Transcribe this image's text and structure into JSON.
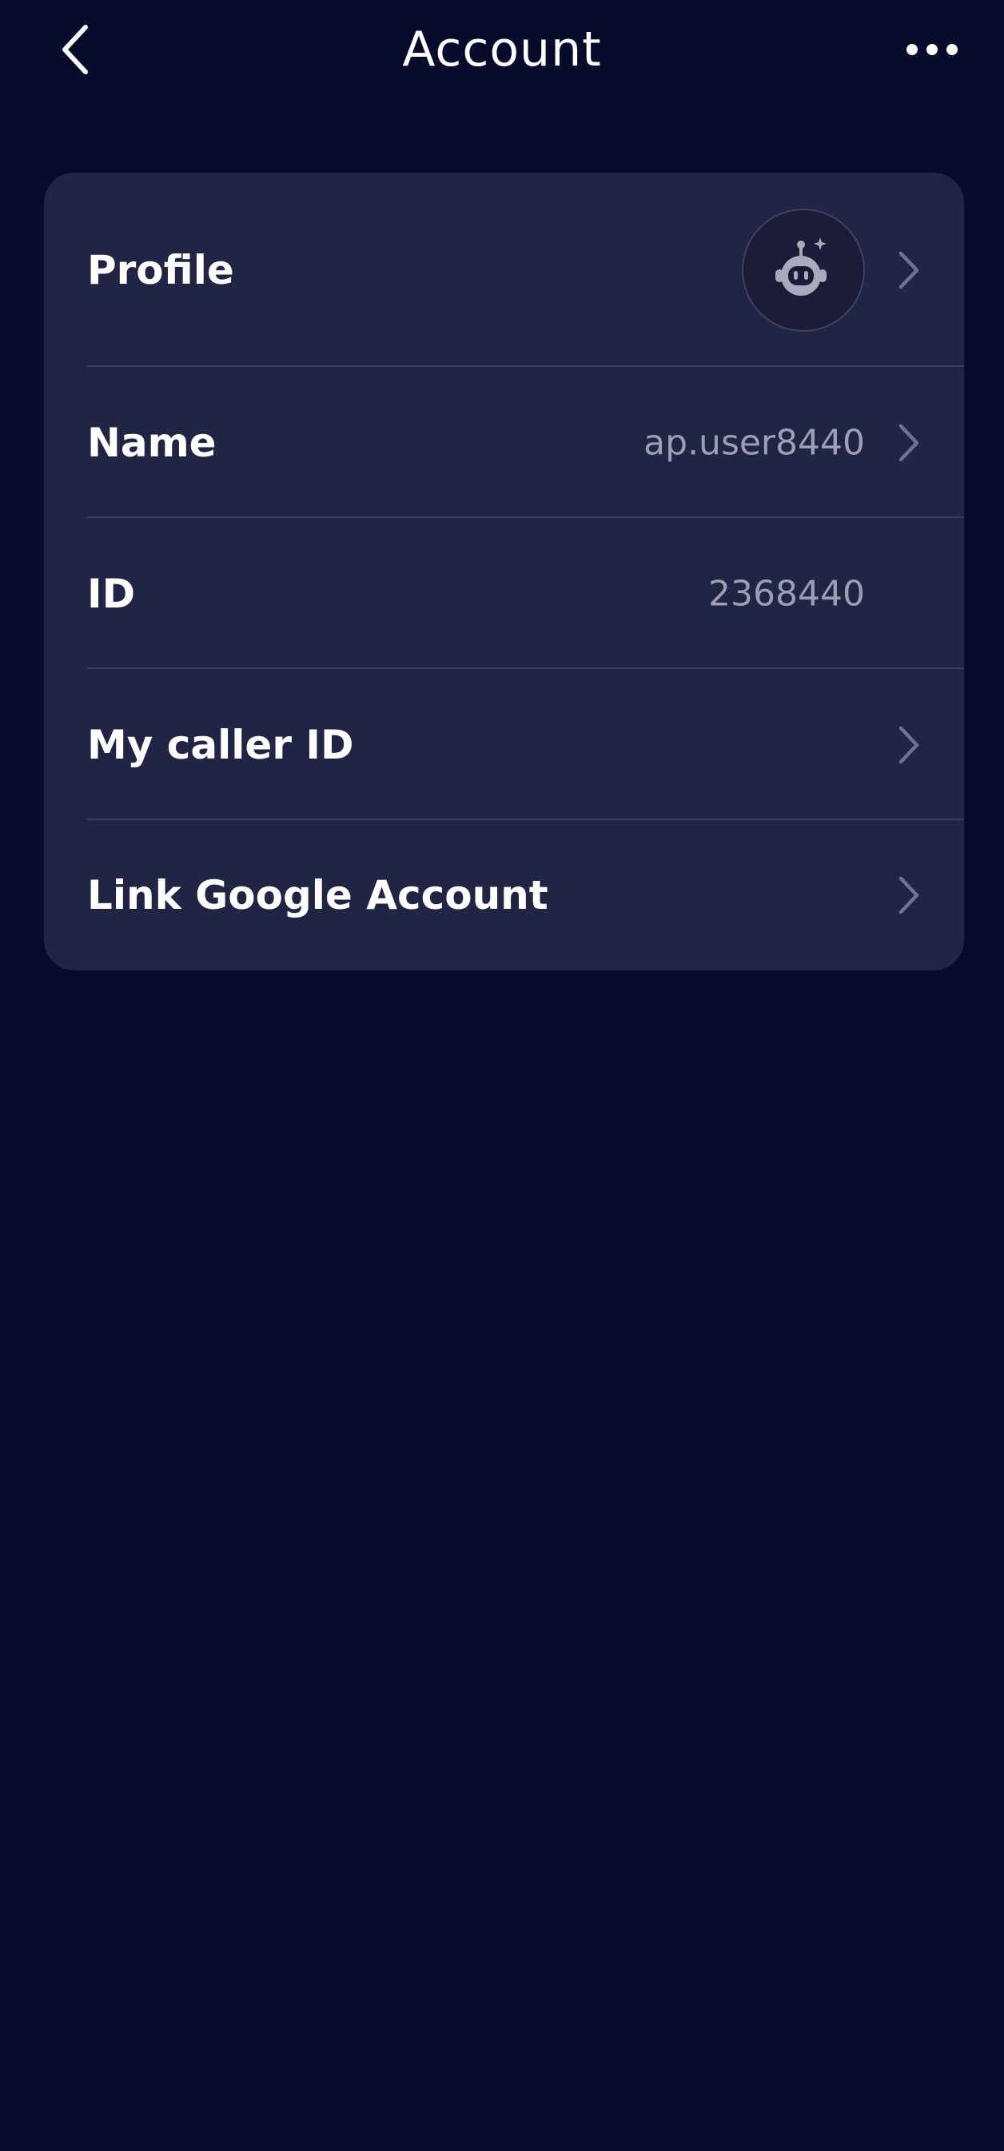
{
  "header": {
    "title": "Account",
    "back_icon": "chevron-left-icon",
    "more_icon": "more-horizontal-icon"
  },
  "account_card": {
    "rows": [
      {
        "label": "Profile",
        "value": "",
        "has_chevron": true,
        "avatar_icon": "robot-avatar-icon"
      },
      {
        "label": "Name",
        "value": "ap.user8440",
        "has_chevron": true
      },
      {
        "label": "ID",
        "value": "2368440",
        "has_chevron": false
      },
      {
        "label": "My caller ID",
        "value": "",
        "has_chevron": true
      },
      {
        "label": "Link Google Account",
        "value": "",
        "has_chevron": true
      }
    ]
  },
  "colors": {
    "background": "#080b2a",
    "card": "#212442",
    "text_primary": "#ffffff",
    "text_secondary": "#9c9eb5",
    "chevron": "#6f7290"
  }
}
